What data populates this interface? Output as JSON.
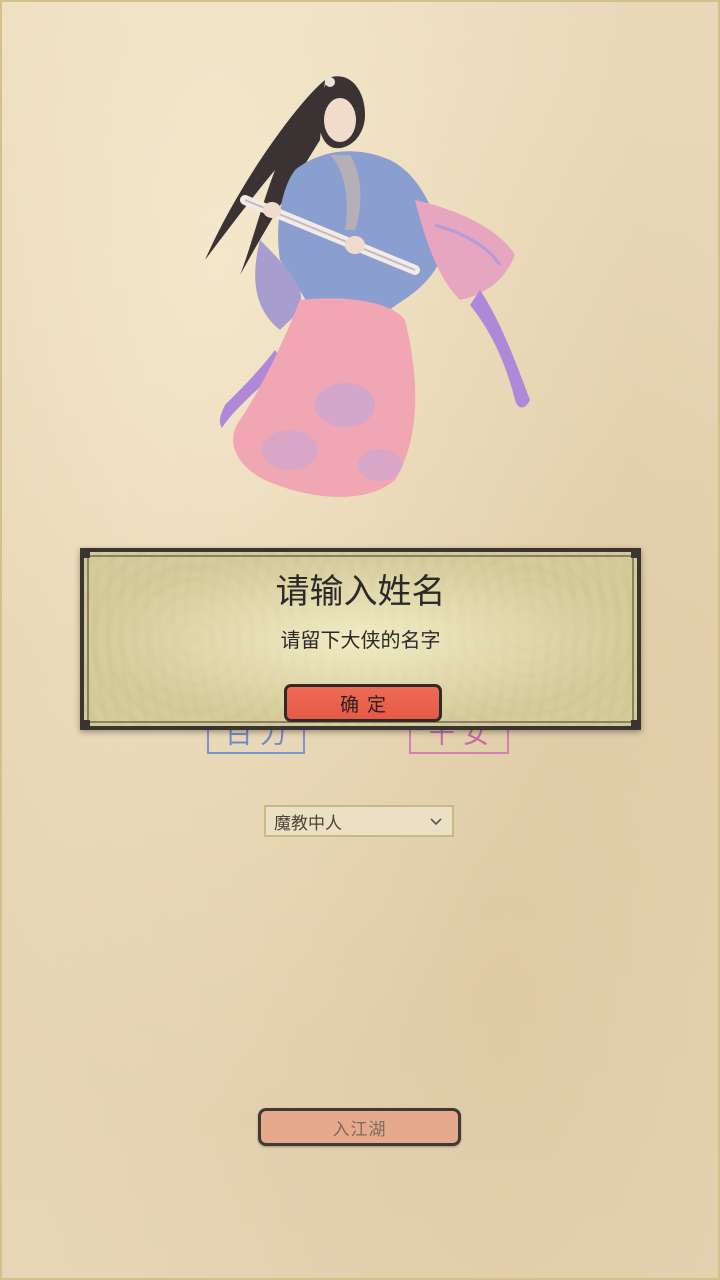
{
  "screen": {
    "background_color": "#e8d6b4"
  },
  "character": {
    "icon": "wuxia-swordswoman-illustration"
  },
  "gender": {
    "male_label": "白 力",
    "female_label": "千 女"
  },
  "faction": {
    "selected": "魔教中人",
    "icon": "chevron-down-icon"
  },
  "enter_button": {
    "label": "入江湖",
    "color": "#e7a98c"
  },
  "dialog": {
    "title": "请输入姓名",
    "message": "请留下大侠的名字",
    "confirm_label": "确定",
    "confirm_color": "#ea624f"
  }
}
